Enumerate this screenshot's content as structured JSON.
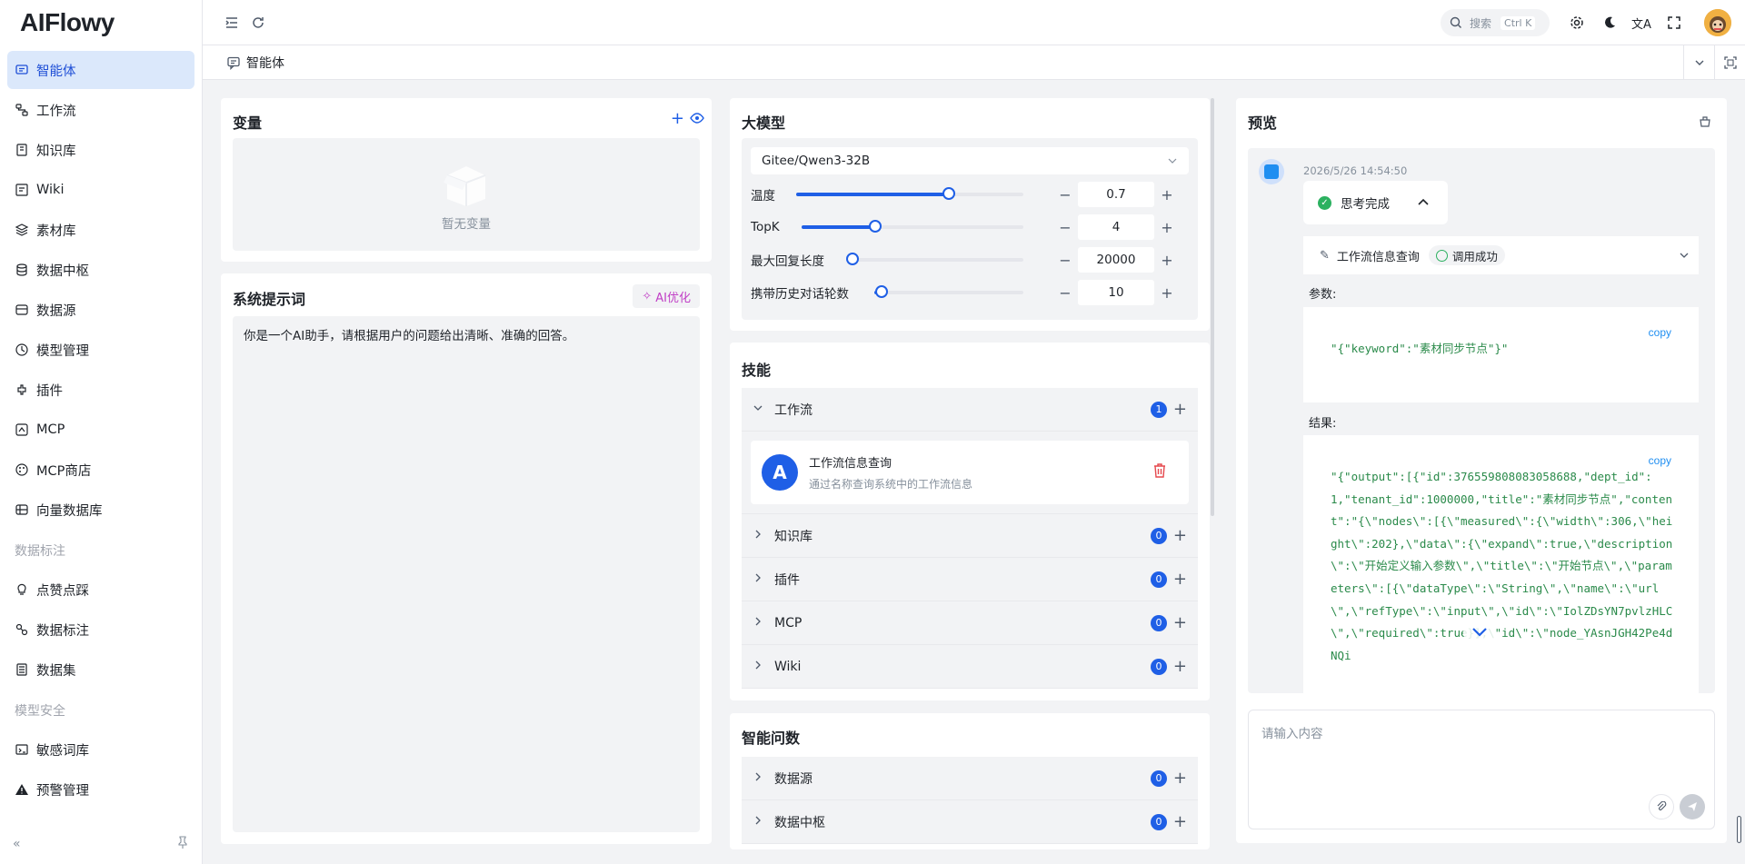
{
  "app": {
    "logo": "AIFlowy"
  },
  "sidebar": {
    "items": [
      {
        "label": "智能体",
        "icon": "agent-icon",
        "active": true
      },
      {
        "label": "工作流",
        "icon": "workflow-icon"
      },
      {
        "label": "知识库",
        "icon": "book-icon"
      },
      {
        "label": "Wiki",
        "icon": "wiki-icon"
      },
      {
        "label": "素材库",
        "icon": "layers-icon"
      },
      {
        "label": "数据中枢",
        "icon": "database-icon"
      },
      {
        "label": "数据源",
        "icon": "datasource-icon"
      },
      {
        "label": "模型管理",
        "icon": "model-icon"
      },
      {
        "label": "插件",
        "icon": "plugin-icon"
      },
      {
        "label": "MCP",
        "icon": "mcp-icon"
      },
      {
        "label": "MCP商店",
        "icon": "store-icon"
      },
      {
        "label": "向量数据库",
        "icon": "vector-db-icon"
      }
    ],
    "group1": "数据标注",
    "group1_items": [
      {
        "label": "点赞点踩",
        "icon": "bulb-icon"
      },
      {
        "label": "数据标注",
        "icon": "annotation-icon"
      },
      {
        "label": "数据集",
        "icon": "dataset-icon"
      }
    ],
    "group2": "模型安全",
    "group2_items": [
      {
        "label": "敏感词库",
        "icon": "sensitive-icon"
      },
      {
        "label": "预警管理",
        "icon": "warning-icon"
      }
    ]
  },
  "header": {
    "search_placeholder": "搜索",
    "search_shortcut": "Ctrl K"
  },
  "tabbar": {
    "current_tab": "智能体"
  },
  "variables": {
    "title": "变量",
    "empty_text": "暂无变量"
  },
  "system_prompt": {
    "title": "系统提示词",
    "ai_optimize": "AI优化",
    "content": "你是一个AI助手，请根据用户的问题给出清晰、准确的回答。"
  },
  "model": {
    "title": "大模型",
    "selected": "Gitee/Qwen3-32B",
    "params": [
      {
        "label": "温度",
        "value": "0.7",
        "ratio": 0.67
      },
      {
        "label": "TopK",
        "value": "4",
        "ratio": 0.33
      },
      {
        "label": "最大回复长度",
        "value": "20000",
        "ratio": 0.0
      },
      {
        "label": "携带历史对话轮数",
        "value": "10",
        "ratio": 0.05
      }
    ]
  },
  "skills": {
    "title": "技能",
    "sections": [
      {
        "label": "工作流",
        "count": "1",
        "expanded": true
      },
      {
        "label": "知识库",
        "count": "0"
      },
      {
        "label": "插件",
        "count": "0"
      },
      {
        "label": "MCP",
        "count": "0"
      },
      {
        "label": "Wiki",
        "count": "0"
      }
    ],
    "workflow_card": {
      "title": "工作流信息查询",
      "desc": "通过名称查询系统中的工作流信息"
    }
  },
  "smart_query": {
    "title": "智能问数",
    "sections": [
      {
        "label": "数据源",
        "count": "0"
      },
      {
        "label": "数据中枢",
        "count": "0"
      }
    ]
  },
  "preview": {
    "title": "预览",
    "timestamp": "2026/5/26 14:54:50",
    "thinking": "思考完成",
    "tool_name": "工作流信息查询",
    "tool_status": "调用成功",
    "params_label": "参数:",
    "params_code": "\"{\"keyword\":\"素材同步节点\"}\"",
    "result_label": "结果:",
    "result_code": "\"{\"output\":[{\"id\":376559808083058688,\"dept_id\":1,\"tenant_id\":1000000,\"title\":\"素材同步节点\",\"content\":\"{\\\"nodes\\\":[{\\\"measured\\\":{\\\"width\\\":306,\\\"height\\\":202},\\\"data\\\":{\\\"expand\\\":true,\\\"description\\\":\\\"开始定义输入参数\\\",\\\"title\\\":\\\"开始节点\\\",\\\"parameters\\\":[{\\\"dataType\\\":\\\"String\\\",\\\"name\\\":\\\"url\\\",\\\"refType\\\":\\\"input\\\",\\\"id\\\":\\\"IolZDsYN7pvlzHLC\\\",\\\"required\\\":true}],\\\"id\\\":\\\"node_YAsnJGH42Pe4dNQi",
    "copy_label": "copy",
    "input_placeholder": "请输入内容"
  },
  "colors": {
    "primary": "#1f5fe6",
    "active_bg": "#dbe8fb",
    "success": "#2cb160",
    "danger": "#e5484d",
    "code": "#2a8a4a"
  }
}
